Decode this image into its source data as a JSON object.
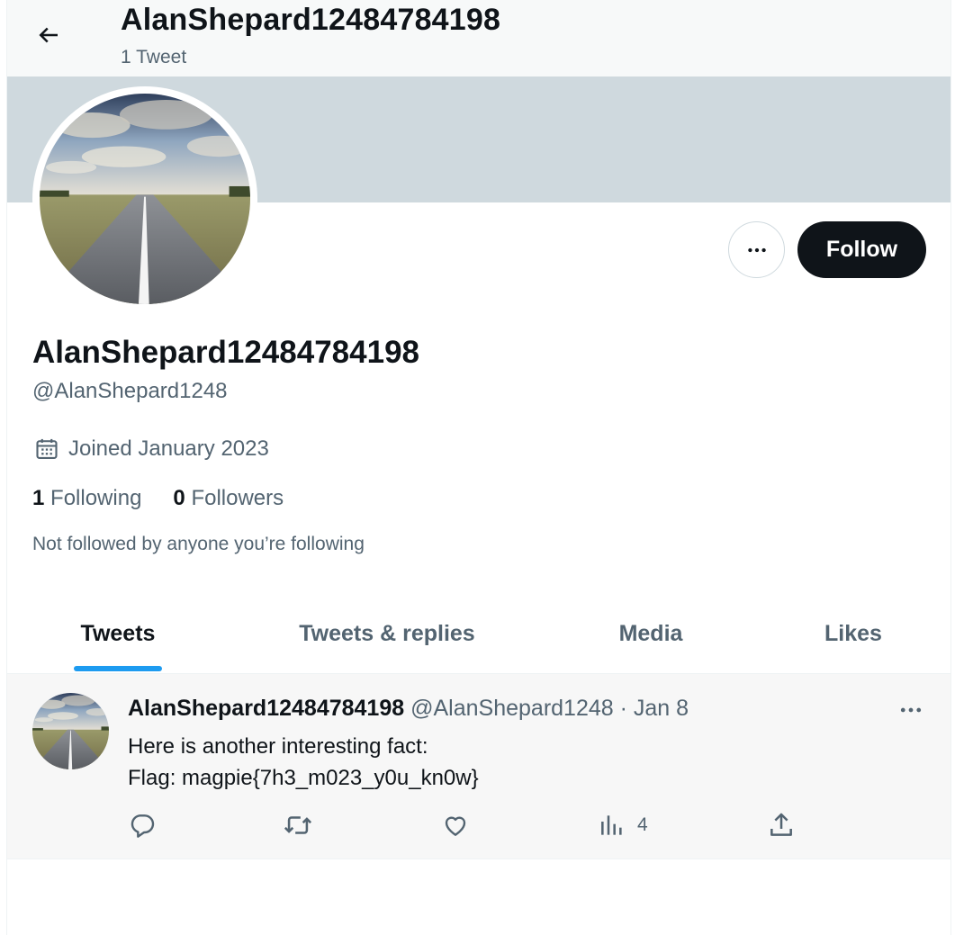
{
  "header": {
    "title": "AlanShepard12484784198",
    "tweet_count": "1 Tweet"
  },
  "profile": {
    "display_name": "AlanShepard12484784198",
    "handle": "@AlanShepard1248",
    "joined": "Joined January 2023",
    "following_count": "1",
    "following_label": "Following",
    "followers_count": "0",
    "followers_label": "Followers",
    "not_followed_text": "Not followed by anyone you’re following",
    "follow_label": "Follow",
    "avatar_image": "road-to-horizon"
  },
  "tabs": [
    {
      "label": "Tweets",
      "active": true
    },
    {
      "label": "Tweets & replies",
      "active": false
    },
    {
      "label": "Media",
      "active": false
    },
    {
      "label": "Likes",
      "active": false
    }
  ],
  "tweet": {
    "name": "AlanShepard12484784198",
    "handle": "@AlanShepard1248",
    "separator": "·",
    "date": "Jan 8",
    "lines": [
      "Here is another interesting fact:",
      "Flag: magpie{7h3_m023_y0u_kn0w}"
    ],
    "views": "4"
  },
  "icons": {
    "back": "arrow-left-icon",
    "more": "more-horizontal-icon",
    "calendar": "calendar-icon",
    "reply": "reply-icon",
    "retweet": "retweet-icon",
    "like": "heart-icon",
    "views": "analytics-icon",
    "share": "share-icon"
  },
  "colors": {
    "accent": "#1d9bf0",
    "text_primary": "#0f1419",
    "text_secondary": "#536471",
    "banner": "#cfd9de",
    "follow_button": "#0f1419"
  }
}
